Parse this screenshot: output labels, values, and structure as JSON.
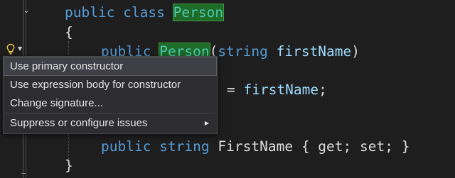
{
  "code": {
    "line1": {
      "kw": "public",
      "kw2": "class",
      "type": "Person"
    },
    "line2": {
      "brace": "{"
    },
    "line3": {
      "kw": "public",
      "type": "Person",
      "open": "(",
      "kw2": "string",
      "param": "firstName",
      "close": ")"
    },
    "line4": {
      "assign": "= ",
      "ident": "firstName",
      "semi": ";"
    },
    "line5": {
      "kw": "public",
      "kw2": "string",
      "name": "FirstName",
      "rest": " { get; set; }"
    },
    "line6": {
      "brace": "}"
    }
  },
  "quick_actions": {
    "icon": "lightbulb-icon",
    "dropdown_icon": "chevron-down-icon"
  },
  "menu": {
    "items": [
      {
        "label": "Use primary constructor",
        "selected": true
      },
      {
        "label": "Use expression body for constructor",
        "selected": false
      },
      {
        "label": "Change signature...",
        "selected": false
      },
      {
        "label": "Suppress or configure issues",
        "selected": false,
        "submenu": true
      }
    ]
  },
  "colors": {
    "background": "#1e1e1e",
    "keyword": "#569cd6",
    "type": "#4ec9b0",
    "identifier": "#9cdcfe",
    "highlight": "#1e6b28",
    "menu_background": "#2d2d30",
    "menu_selected": "#3f3f46"
  }
}
